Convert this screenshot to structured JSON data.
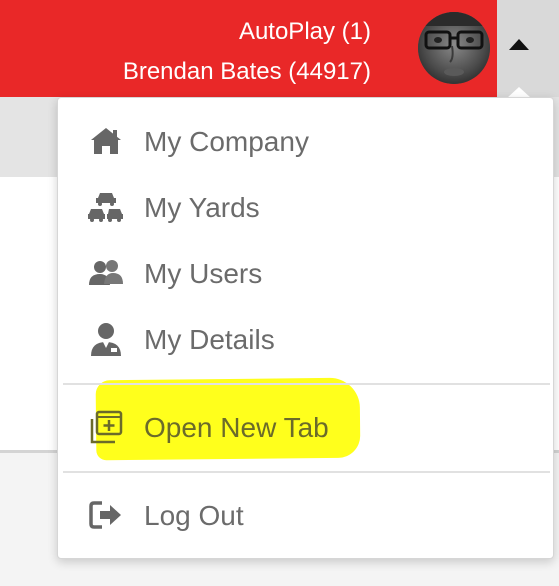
{
  "header": {
    "line1": "AutoPlay (1)",
    "line2": "Brendan Bates (44917)",
    "accent_color": "#e92828"
  },
  "toggle": {
    "icon": "caret-up-icon"
  },
  "menu": {
    "items": [
      {
        "label": "My Company",
        "icon": "home-icon"
      },
      {
        "label": "My Yards",
        "icon": "cars-icon"
      },
      {
        "label": "My Users",
        "icon": "users-icon"
      },
      {
        "label": "My Details",
        "icon": "user-details-icon"
      },
      {
        "label": "Open New Tab",
        "icon": "new-tab-icon",
        "highlighted": true,
        "highlight_color": "#ffff1c"
      },
      {
        "label": "Log Out",
        "icon": "logout-icon"
      }
    ]
  }
}
